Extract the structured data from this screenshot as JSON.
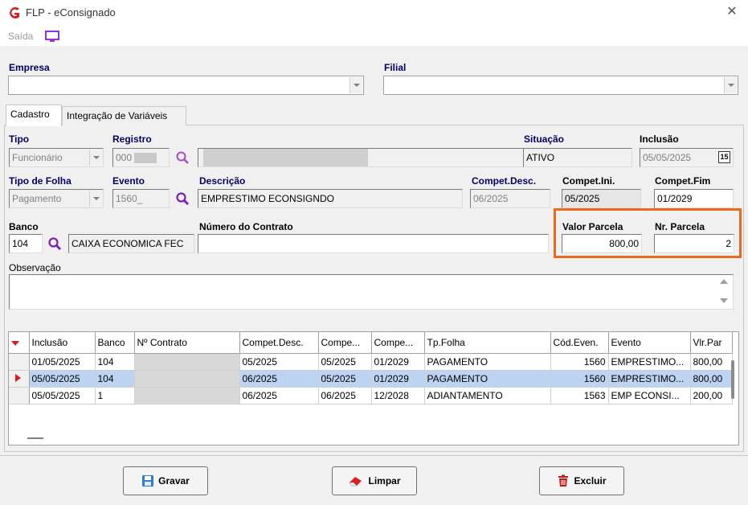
{
  "window": {
    "title": "FLP - eConsignado",
    "close_glyph": "✕",
    "icon": "app-logo-icon"
  },
  "menu": {
    "saida": "Saída",
    "monitor_icon": "monitor-icon"
  },
  "empresa": {
    "label": "Empresa",
    "value": ""
  },
  "filial": {
    "label": "Filial",
    "value": ""
  },
  "tabs": [
    {
      "label": "Cadastro",
      "active": true
    },
    {
      "label": "Integração de Variáveis",
      "active": false
    }
  ],
  "form": {
    "tipo": {
      "label": "Tipo",
      "value": "Funcionário"
    },
    "registro": {
      "label": "Registro",
      "value": "000"
    },
    "nome": {
      "value": ""
    },
    "situacao": {
      "label": "Situação",
      "value": "ATIVO"
    },
    "inclusao": {
      "label": "Inclusão",
      "value": "05/05/2025",
      "cal_glyph": "15"
    },
    "tipo_folha": {
      "label": "Tipo de Folha",
      "value": "Pagamento"
    },
    "evento": {
      "label": "Evento",
      "value": "1560_"
    },
    "descricao": {
      "label": "Descrição",
      "value": "EMPRESTIMO ECONSIGNDO"
    },
    "compet_desc": {
      "label": "Compet.Desc.",
      "value": "06/2025"
    },
    "compet_ini": {
      "label": "Compet.Ini.",
      "value": "05/2025"
    },
    "compet_fim": {
      "label": "Compet.Fim",
      "value": "01/2029"
    },
    "banco": {
      "label": "Banco",
      "code": "104",
      "name": "CAIXA ECONOMICA FEC"
    },
    "contrato": {
      "label": "Número do Contrato",
      "value": ""
    },
    "valor_parcela": {
      "label": "Valor Parcela",
      "value": "800,00"
    },
    "nr_parcela": {
      "label": "Nr. Parcela",
      "value": "2"
    },
    "observacao": {
      "label": "Observação",
      "value": ""
    }
  },
  "grid": {
    "columns": [
      "Inclusão",
      "Banco",
      "Nº Contrato",
      "Compet.Desc.",
      "Compe...",
      "Compe...",
      "Tp.Folha",
      "Cód.Even.",
      "Evento",
      "Vlr.Par"
    ],
    "rows": [
      {
        "selected": false,
        "cells": [
          "01/05/2025",
          "104",
          "",
          "05/2025",
          "05/2025",
          "01/2029",
          "PAGAMENTO",
          "1560",
          "EMPRESTIMO...",
          "800,00"
        ]
      },
      {
        "selected": true,
        "cells": [
          "05/05/2025",
          "104",
          "",
          "06/2025",
          "05/2025",
          "01/2029",
          "PAGAMENTO",
          "1560",
          "EMPRESTIMO...",
          "800,00"
        ]
      },
      {
        "selected": false,
        "cells": [
          "05/05/2025",
          "1",
          "",
          "06/2025",
          "06/2025",
          "12/2028",
          "ADIANTAMENTO",
          "1563",
          "EMP ECONSI...",
          "200,00"
        ]
      }
    ]
  },
  "buttons": {
    "gravar": "Gravar",
    "limpar": "Limpar",
    "excluir": "Excluir"
  },
  "colors": {
    "accent_orange": "#ec6a1c",
    "label_blue": "#000066",
    "selection": "#bcd3f2",
    "purple": "#9b30d9"
  }
}
